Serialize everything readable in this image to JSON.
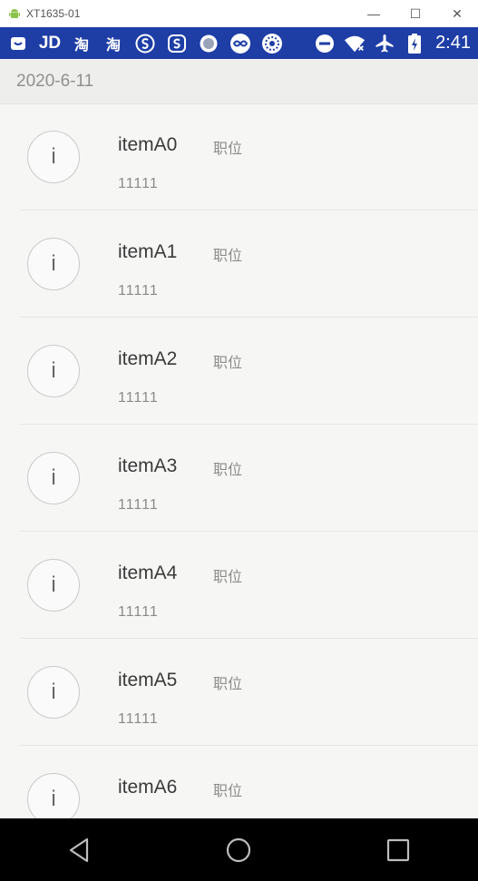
{
  "window": {
    "title": "XT1635-01",
    "minimize": "—",
    "maximize": "☐",
    "close": "✕"
  },
  "statusbar": {
    "icons": [
      "message-icon",
      "jd-icon",
      "taobao-icon",
      "taobao-icon",
      "sogou-icon",
      "sogou-s-icon",
      "circle-icon",
      "infinity-icon",
      "settings-icon"
    ],
    "jd_label": "JD",
    "taobao_label": "淘",
    "time": "2:41"
  },
  "header": {
    "date": "2020-6-11"
  },
  "items": [
    {
      "avatar": "i",
      "name": "itemA0",
      "position": "职位",
      "number": "11111"
    },
    {
      "avatar": "i",
      "name": "itemA1",
      "position": "职位",
      "number": "11111"
    },
    {
      "avatar": "i",
      "name": "itemA2",
      "position": "职位",
      "number": "11111"
    },
    {
      "avatar": "i",
      "name": "itemA3",
      "position": "职位",
      "number": "11111"
    },
    {
      "avatar": "i",
      "name": "itemA4",
      "position": "职位",
      "number": "11111"
    },
    {
      "avatar": "i",
      "name": "itemA5",
      "position": "职位",
      "number": "11111"
    },
    {
      "avatar": "i",
      "name": "itemA6",
      "position": "职位",
      "number": ""
    }
  ],
  "colors": {
    "statusbar": "#1e3ea6",
    "background": "#f6f7f5",
    "header": "#eeefed"
  }
}
